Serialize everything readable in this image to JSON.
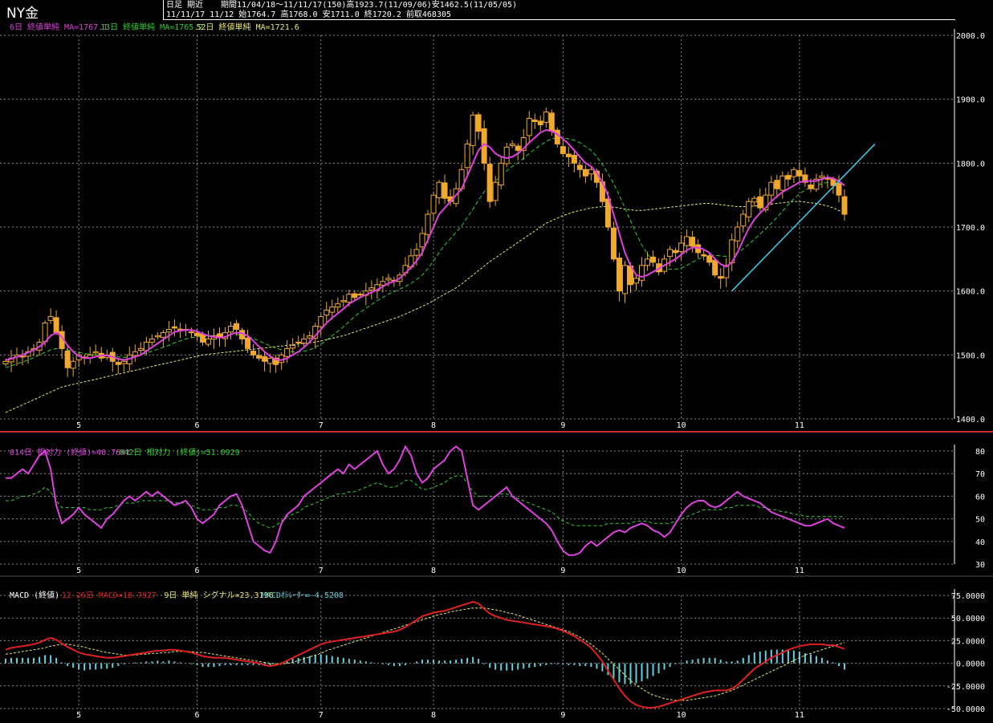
{
  "header": {
    "title": "NY金",
    "line1_a": "日足 期近",
    "line1_b": "期間11/04/18～11/11/17(150)高1923.7(11/09/06)安1462.5(11/05/05)",
    "line2": "11/11/17 11/12 始1764.7 高1768.0 安1711.0 終1720.2 前取468305"
  },
  "colors": {
    "background": "#000000",
    "grid": "#8a8a8a",
    "candle": "#f0a830",
    "ma_short": "#e040e0",
    "ma_mid": "#30d030",
    "ma_long": "#e8e870",
    "rsi_short": "#e040e0",
    "rsi_long": "#30d030",
    "macd": "#e02020",
    "signal": "#e8e870",
    "histogram": "#60d0e0",
    "trendline": "#40c8f0",
    "separator": "#c03030"
  },
  "chart_data": [
    {
      "type": "candlestick",
      "name": "price",
      "ylim": [
        1400,
        2000
      ],
      "yticks": [
        "2000.0",
        "1900.0",
        "1800.0",
        "1700.0",
        "1600.0",
        "1500.0",
        "1400.0"
      ],
      "yticks_values": [
        2000,
        1900,
        1800,
        1700,
        1600,
        1500,
        1400
      ],
      "xticks": [
        "5",
        "6",
        "7",
        "8",
        "9",
        "10",
        "11"
      ],
      "xticks_index": [
        13,
        34,
        56,
        76,
        99,
        120,
        141
      ],
      "legend": [
        {
          "label": "6日 終値単純 MA=1767.1",
          "color": "#e040e0"
        },
        {
          "label": "13日 終値単純 MA=1765.2",
          "color": "#30d030"
        },
        {
          "label": "52日 終値単純 MA=1721.6",
          "color": "#e8e870"
        }
      ],
      "closes": [
        1490,
        1495,
        1500,
        1498,
        1505,
        1510,
        1520,
        1550,
        1560,
        1535,
        1510,
        1480,
        1490,
        1500,
        1495,
        1500,
        1505,
        1495,
        1500,
        1490,
        1485,
        1490,
        1500,
        1505,
        1510,
        1520,
        1525,
        1530,
        1535,
        1540,
        1542,
        1538,
        1540,
        1535,
        1530,
        1520,
        1525,
        1530,
        1528,
        1535,
        1545,
        1540,
        1525,
        1510,
        1500,
        1495,
        1490,
        1495,
        1485,
        1500,
        1510,
        1515,
        1520,
        1525,
        1530,
        1545,
        1560,
        1570,
        1575,
        1580,
        1585,
        1595,
        1590,
        1595,
        1600,
        1605,
        1610,
        1615,
        1620,
        1615,
        1625,
        1640,
        1655,
        1665,
        1690,
        1720,
        1750,
        1770,
        1745,
        1740,
        1760,
        1790,
        1830,
        1875,
        1850,
        1800,
        1740,
        1770,
        1800,
        1825,
        1830,
        1820,
        1840,
        1870,
        1865,
        1860,
        1880,
        1850,
        1830,
        1815,
        1810,
        1800,
        1790,
        1780,
        1790,
        1770,
        1740,
        1700,
        1650,
        1600,
        1640,
        1610,
        1620,
        1640,
        1650,
        1645,
        1630,
        1650,
        1665,
        1660,
        1675,
        1685,
        1670,
        1660,
        1655,
        1645,
        1625,
        1620,
        1640,
        1680,
        1700,
        1720,
        1740,
        1745,
        1730,
        1750,
        1770,
        1760,
        1780,
        1775,
        1790,
        1780,
        1770,
        1760,
        1775,
        1780,
        1775,
        1765,
        1750,
        1720
      ],
      "ma_short": [
        1492,
        1494,
        1497,
        1500,
        1504,
        1508,
        1513,
        1520,
        1530,
        1535,
        1528,
        1515,
        1505,
        1498,
        1495,
        1495,
        1497,
        1499,
        1499,
        1497,
        1494,
        1492,
        1494,
        1497,
        1500,
        1506,
        1512,
        1518,
        1524,
        1530,
        1536,
        1538,
        1539,
        1539,
        1537,
        1533,
        1530,
        1528,
        1527,
        1528,
        1532,
        1535,
        1534,
        1530,
        1522,
        1513,
        1505,
        1498,
        1493,
        1492,
        1495,
        1500,
        1505,
        1512,
        1520,
        1530,
        1540,
        1550,
        1558,
        1565,
        1572,
        1580,
        1585,
        1590,
        1594,
        1598,
        1602,
        1607,
        1612,
        1615,
        1620,
        1628,
        1637,
        1647,
        1660,
        1680,
        1700,
        1720,
        1730,
        1740,
        1750,
        1760,
        1780,
        1800,
        1820,
        1830,
        1825,
        1815,
        1810,
        1808,
        1810,
        1815,
        1823,
        1832,
        1840,
        1848,
        1852,
        1850,
        1845,
        1838,
        1830,
        1820,
        1810,
        1800,
        1795,
        1785,
        1770,
        1750,
        1720,
        1690,
        1660,
        1640,
        1625,
        1622,
        1625,
        1630,
        1635,
        1640,
        1645,
        1650,
        1657,
        1664,
        1668,
        1668,
        1665,
        1660,
        1650,
        1642,
        1638,
        1645,
        1660,
        1680,
        1698,
        1712,
        1722,
        1730,
        1740,
        1748,
        1755,
        1760,
        1765,
        1770,
        1772,
        1772,
        1772,
        1775,
        1778,
        1776,
        1772,
        1765
      ],
      "ma_mid": [
        1480,
        1483,
        1486,
        1489,
        1492,
        1496,
        1500,
        1504,
        1508,
        1510,
        1510,
        1508,
        1506,
        1504,
        1502,
        1501,
        1500,
        1500,
        1499,
        1498,
        1497,
        1496,
        1497,
        1498,
        1500,
        1503,
        1506,
        1509,
        1512,
        1515,
        1519,
        1522,
        1525,
        1527,
        1528,
        1529,
        1530,
        1530,
        1530,
        1531,
        1532,
        1532,
        1531,
        1529,
        1526,
        1522,
        1518,
        1514,
        1511,
        1508,
        1506,
        1505,
        1505,
        1506,
        1508,
        1512,
        1517,
        1523,
        1530,
        1537,
        1544,
        1552,
        1560,
        1567,
        1573,
        1579,
        1585,
        1590,
        1595,
        1599,
        1603,
        1607,
        1612,
        1618,
        1625,
        1635,
        1647,
        1660,
        1672,
        1682,
        1692,
        1702,
        1715,
        1728,
        1742,
        1755,
        1765,
        1772,
        1780,
        1788,
        1795,
        1800,
        1808,
        1815,
        1822,
        1828,
        1834,
        1838,
        1840,
        1840,
        1838,
        1836,
        1832,
        1826,
        1820,
        1810,
        1798,
        1784,
        1768,
        1750,
        1730,
        1710,
        1690,
        1672,
        1658,
        1648,
        1640,
        1636,
        1634,
        1634,
        1636,
        1640,
        1645,
        1650,
        1654,
        1656,
        1656,
        1655,
        1654,
        1656,
        1660,
        1666,
        1673,
        1681,
        1689,
        1697,
        1706,
        1715,
        1725,
        1735,
        1744,
        1752,
        1758,
        1762,
        1765,
        1768,
        1770,
        1770,
        1768,
        1765
      ],
      "ma_long": [
        1410,
        1414,
        1418,
        1422,
        1426,
        1430,
        1434,
        1438,
        1442,
        1446,
        1450,
        1452,
        1454,
        1456,
        1458,
        1460,
        1462,
        1464,
        1466,
        1468,
        1470,
        1472,
        1474,
        1476,
        1478,
        1480,
        1482,
        1484,
        1486,
        1488,
        1490,
        1492,
        1494,
        1496,
        1498,
        1500,
        1501,
        1502,
        1503,
        1504,
        1505,
        1506,
        1507,
        1508,
        1509,
        1510,
        1511,
        1512,
        1513,
        1514,
        1515,
        1516,
        1517,
        1518,
        1519,
        1520,
        1522,
        1524,
        1526,
        1528,
        1530,
        1533,
        1536,
        1539,
        1542,
        1545,
        1548,
        1551,
        1554,
        1557,
        1560,
        1564,
        1568,
        1572,
        1576,
        1580,
        1585,
        1590,
        1595,
        1600,
        1605,
        1611,
        1618,
        1625,
        1632,
        1639,
        1646,
        1652,
        1658,
        1664,
        1670,
        1676,
        1682,
        1688,
        1694,
        1700,
        1706,
        1710,
        1714,
        1718,
        1721,
        1724,
        1726,
        1728,
        1730,
        1731,
        1732,
        1732,
        1731,
        1730,
        1728,
        1727,
        1726,
        1726,
        1727,
        1728,
        1729,
        1730,
        1731,
        1732,
        1733,
        1734,
        1735,
        1736,
        1737,
        1737,
        1736,
        1735,
        1734,
        1733,
        1732,
        1732,
        1732,
        1733,
        1734,
        1735,
        1736,
        1737,
        1738,
        1739,
        1740,
        1740,
        1739,
        1738,
        1737,
        1735,
        1733,
        1730,
        1726,
        1722
      ]
    },
    {
      "type": "line",
      "name": "rsi",
      "ylim": [
        30,
        80
      ],
      "yticks": [
        "80",
        "70",
        "60",
        "50",
        "40",
        "30"
      ],
      "yticks_values": [
        80,
        70,
        60,
        50,
        40,
        30
      ],
      "xticks": [
        "5",
        "6",
        "7",
        "8",
        "9",
        "10",
        "11"
      ],
      "legend": [
        {
          "label": "014日 相対力 (終値)=46.7641",
          "color": "#e040e0"
        },
        {
          "label": "042日 相対力 (終値)=51.0929",
          "color": "#30d030"
        }
      ],
      "series_short": [
        68,
        68,
        70,
        72,
        70,
        74,
        78,
        80,
        72,
        56,
        48,
        50,
        52,
        55,
        52,
        50,
        48,
        46,
        50,
        52,
        55,
        58,
        60,
        58,
        60,
        62,
        60,
        62,
        60,
        58,
        56,
        57,
        58,
        55,
        50,
        48,
        50,
        52,
        56,
        58,
        60,
        61,
        56,
        48,
        40,
        38,
        36,
        35,
        40,
        48,
        52,
        54,
        56,
        60,
        62,
        64,
        66,
        68,
        70,
        72,
        70,
        74,
        72,
        74,
        76,
        78,
        80,
        74,
        70,
        72,
        76,
        82,
        78,
        70,
        66,
        68,
        72,
        74,
        76,
        80,
        82,
        80,
        68,
        56,
        54,
        56,
        58,
        60,
        62,
        64,
        60,
        58,
        56,
        54,
        52,
        50,
        48,
        45,
        40,
        36,
        34,
        34,
        35,
        38,
        40,
        38,
        40,
        42,
        44,
        45,
        44,
        46,
        47,
        48,
        47,
        45,
        44,
        42,
        44,
        48,
        52,
        55,
        57,
        58,
        58,
        56,
        55,
        56,
        58,
        60,
        62,
        60,
        59,
        58,
        57,
        55,
        53,
        52,
        51,
        50,
        49,
        48,
        47,
        47,
        48,
        49,
        50,
        48,
        47,
        46
      ],
      "series_long": [
        58,
        58,
        59,
        60,
        60,
        61,
        62,
        64,
        62,
        58,
        55,
        55,
        55,
        55,
        55,
        54,
        54,
        54,
        55,
        55,
        56,
        57,
        57,
        57,
        58,
        58,
        58,
        58,
        58,
        58,
        57,
        57,
        57,
        56,
        55,
        54,
        54,
        54,
        55,
        55,
        56,
        56,
        55,
        53,
        50,
        48,
        47,
        46,
        47,
        49,
        51,
        52,
        53,
        55,
        56,
        57,
        58,
        59,
        60,
        61,
        61,
        62,
        62,
        63,
        64,
        65,
        66,
        65,
        64,
        64,
        65,
        67,
        67,
        65,
        63,
        63,
        64,
        65,
        66,
        68,
        69,
        69,
        66,
        62,
        60,
        60,
        60,
        60,
        61,
        61,
        60,
        59,
        58,
        57,
        56,
        55,
        54,
        53,
        51,
        49,
        48,
        47,
        47,
        47,
        47,
        47,
        47,
        48,
        48,
        48,
        48,
        48,
        49,
        49,
        49,
        48,
        48,
        48,
        48,
        49,
        50,
        51,
        52,
        53,
        54,
        54,
        54,
        54,
        55,
        55,
        56,
        56,
        56,
        56,
        55,
        55,
        54,
        54,
        53,
        53,
        52,
        52,
        51,
        51,
        51,
        51,
        51,
        51,
        51,
        51
      ]
    },
    {
      "type": "macd",
      "name": "macd",
      "ylim": [
        -50,
        75
      ],
      "yticks": [
        "75.0000",
        "50.0000",
        "25.0000",
        "0.0000",
        "-25.0000",
        "-50.0000"
      ],
      "yticks_values": [
        75,
        50,
        25,
        0,
        -25,
        -50
      ],
      "xticks": [
        "5",
        "6",
        "7",
        "8",
        "9",
        "10",
        "11"
      ],
      "legend": [
        {
          "label": "MACD (終値)",
          "color": "#ffffff"
        },
        {
          "label": "12-26日 MACD=18.7927",
          "color": "#e02020"
        },
        {
          "label": "9日 単純 シグナル=23.3136",
          "color": "#e8e870"
        },
        {
          "label": "MACDｵｼﾚｰﾀｰ=-4.5208",
          "color": "#60d0e0"
        }
      ],
      "macd": [
        15,
        17,
        18,
        19,
        20,
        21,
        23,
        26,
        28,
        26,
        22,
        18,
        15,
        12,
        10,
        9,
        8,
        7,
        6,
        6,
        7,
        8,
        9,
        10,
        11,
        12,
        13,
        14,
        14,
        15,
        15,
        14,
        13,
        12,
        10,
        8,
        7,
        6,
        6,
        6,
        5,
        4,
        3,
        2,
        1,
        0,
        -2,
        -3,
        -2,
        0,
        3,
        6,
        9,
        12,
        15,
        18,
        21,
        23,
        24,
        25,
        26,
        27,
        28,
        29,
        30,
        31,
        32,
        33,
        34,
        35,
        37,
        40,
        44,
        48,
        52,
        54,
        56,
        57,
        58,
        60,
        62,
        64,
        66,
        68,
        66,
        60,
        55,
        52,
        50,
        48,
        47,
        46,
        45,
        44,
        43,
        42,
        41,
        40,
        38,
        36,
        33,
        30,
        26,
        22,
        17,
        10,
        2,
        -8,
        -18,
        -28,
        -36,
        -42,
        -46,
        -48,
        -49,
        -49,
        -48,
        -46,
        -44,
        -42,
        -40,
        -38,
        -36,
        -34,
        -32,
        -31,
        -30,
        -30,
        -30,
        -28,
        -24,
        -18,
        -12,
        -6,
        -2,
        2,
        6,
        9,
        12,
        15,
        17,
        19,
        20,
        21,
        21,
        21,
        20,
        20,
        18,
        16
      ],
      "signal": [
        10,
        11,
        12,
        13,
        14,
        15,
        16,
        17,
        19,
        20,
        21,
        21,
        20,
        19,
        18,
        16,
        15,
        13,
        12,
        11,
        10,
        9,
        9,
        9,
        10,
        10,
        11,
        11,
        12,
        12,
        13,
        13,
        13,
        13,
        12,
        12,
        11,
        10,
        9,
        8,
        7,
        6,
        5,
        4,
        3,
        2,
        1,
        0,
        -1,
        -1,
        0,
        1,
        3,
        5,
        7,
        9,
        11,
        14,
        16,
        18,
        20,
        22,
        24,
        26,
        28,
        30,
        32,
        34,
        36,
        38,
        40,
        42,
        44,
        46,
        48,
        50,
        52,
        54,
        55,
        57,
        58,
        59,
        60,
        61,
        61,
        61,
        60,
        59,
        58,
        56,
        55,
        53,
        51,
        49,
        47,
        45,
        43,
        41,
        39,
        37,
        35,
        32,
        29,
        25,
        21,
        16,
        11,
        5,
        -1,
        -7,
        -13,
        -19,
        -24,
        -28,
        -32,
        -35,
        -37,
        -39,
        -40,
        -41,
        -41,
        -41,
        -40,
        -39,
        -38,
        -37,
        -36,
        -34,
        -32,
        -30,
        -27,
        -24,
        -21,
        -18,
        -15,
        -12,
        -9,
        -6,
        -3,
        0,
        3,
        6,
        9,
        11,
        13,
        15,
        17,
        19,
        21,
        23
      ]
    }
  ]
}
